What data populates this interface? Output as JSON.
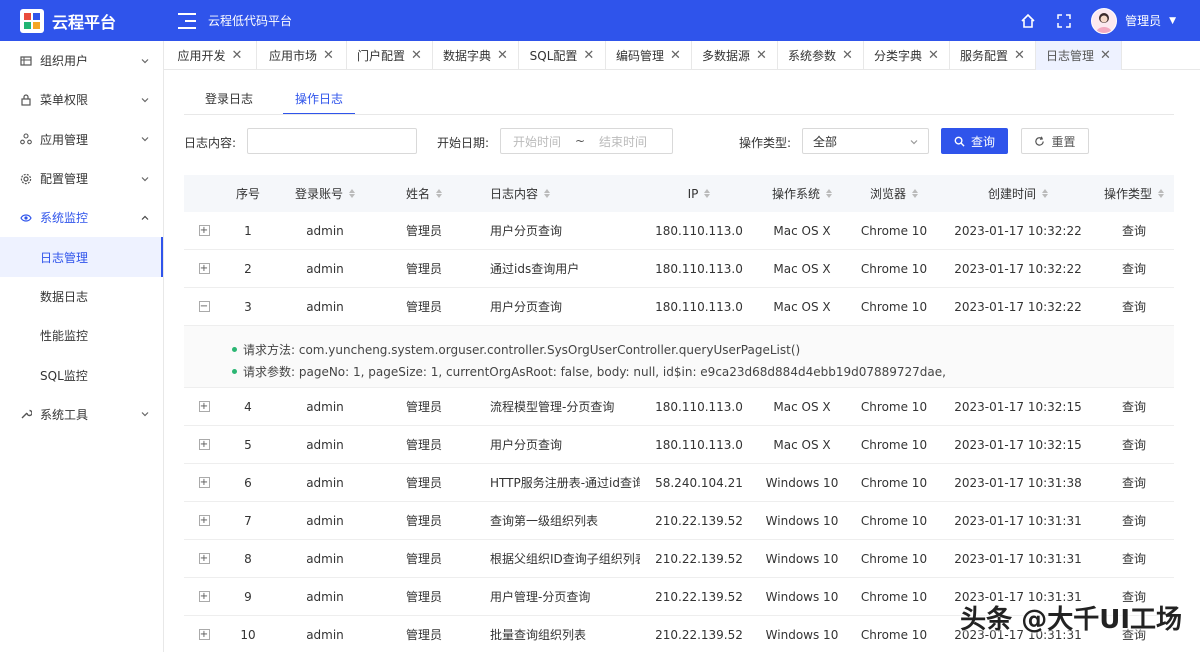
{
  "header": {
    "logo_text": "云程平台",
    "app_title": "云程低代码平台",
    "user_name": "管理员",
    "colors": {
      "primary": "#2f54eb"
    }
  },
  "sidebar": {
    "items": [
      {
        "label": "组织用户",
        "icon": "org-icon",
        "expanded": false
      },
      {
        "label": "菜单权限",
        "icon": "lock-icon",
        "expanded": false
      },
      {
        "label": "应用管理",
        "icon": "app-icon",
        "expanded": false
      },
      {
        "label": "配置管理",
        "icon": "gear-icon",
        "expanded": false
      },
      {
        "label": "系统监控",
        "icon": "eye-icon",
        "expanded": true
      },
      {
        "label": "系统工具",
        "icon": "wrench-icon",
        "expanded": false
      }
    ],
    "sub_items": [
      {
        "label": "日志管理",
        "active": true
      },
      {
        "label": "数据日志",
        "active": false
      },
      {
        "label": "性能监控",
        "active": false
      },
      {
        "label": "SQL监控",
        "active": false
      }
    ]
  },
  "tabs": [
    {
      "label": "应用开发",
      "active": false
    },
    {
      "label": "应用市场",
      "active": false
    },
    {
      "label": "门户配置",
      "active": false
    },
    {
      "label": "数据字典",
      "active": false
    },
    {
      "label": "SQL配置",
      "active": false
    },
    {
      "label": "编码管理",
      "active": false
    },
    {
      "label": "多数据源",
      "active": false
    },
    {
      "label": "系统参数",
      "active": false
    },
    {
      "label": "分类字典",
      "active": false
    },
    {
      "label": "服务配置",
      "active": false
    },
    {
      "label": "日志管理",
      "active": true
    }
  ],
  "subtabs": {
    "login_log": "登录日志",
    "operation_log": "操作日志"
  },
  "filters": {
    "content_label": "日志内容:",
    "date_label": "开始日期:",
    "start_placeholder": "开始时间",
    "range_sep": "~",
    "end_placeholder": "结束时间",
    "type_label": "操作类型:",
    "type_value": "全部",
    "query_button": "查询",
    "reset_button": "重置"
  },
  "table": {
    "columns": [
      "序号",
      "登录账号",
      "姓名",
      "日志内容",
      "IP",
      "操作系统",
      "浏览器",
      "创建时间",
      "操作类型"
    ],
    "rows": [
      {
        "no": "1",
        "account": "admin",
        "name": "管理员",
        "content": "用户分页查询",
        "ip": "180.110.113.0",
        "os": "Mac OS X",
        "browser": "Chrome 10",
        "time": "2023-01-17 10:32:22",
        "type": "查询",
        "expanded": false
      },
      {
        "no": "2",
        "account": "admin",
        "name": "管理员",
        "content": "通过ids查询用户",
        "ip": "180.110.113.0",
        "os": "Mac OS X",
        "browser": "Chrome 10",
        "time": "2023-01-17 10:32:22",
        "type": "查询",
        "expanded": false
      },
      {
        "no": "3",
        "account": "admin",
        "name": "管理员",
        "content": "用户分页查询",
        "ip": "180.110.113.0",
        "os": "Mac OS X",
        "browser": "Chrome 10",
        "time": "2023-01-17 10:32:22",
        "type": "查询",
        "expanded": true
      },
      {
        "no": "4",
        "account": "admin",
        "name": "管理员",
        "content": "流程模型管理-分页查询",
        "ip": "180.110.113.0",
        "os": "Mac OS X",
        "browser": "Chrome 10",
        "time": "2023-01-17 10:32:15",
        "type": "查询",
        "expanded": false
      },
      {
        "no": "5",
        "account": "admin",
        "name": "管理员",
        "content": "用户分页查询",
        "ip": "180.110.113.0",
        "os": "Mac OS X",
        "browser": "Chrome 10",
        "time": "2023-01-17 10:32:15",
        "type": "查询",
        "expanded": false
      },
      {
        "no": "6",
        "account": "admin",
        "name": "管理员",
        "content": "HTTP服务注册表-通过id查询",
        "ip": "58.240.104.21",
        "os": "Windows 10",
        "browser": "Chrome 10",
        "time": "2023-01-17 10:31:38",
        "type": "查询",
        "expanded": false
      },
      {
        "no": "7",
        "account": "admin",
        "name": "管理员",
        "content": "查询第一级组织列表",
        "ip": "210.22.139.52",
        "os": "Windows 10",
        "browser": "Chrome 10",
        "time": "2023-01-17 10:31:31",
        "type": "查询",
        "expanded": false
      },
      {
        "no": "8",
        "account": "admin",
        "name": "管理员",
        "content": "根据父组织ID查询子组织列表",
        "ip": "210.22.139.52",
        "os": "Windows 10",
        "browser": "Chrome 10",
        "time": "2023-01-17 10:31:31",
        "type": "查询",
        "expanded": false
      },
      {
        "no": "9",
        "account": "admin",
        "name": "管理员",
        "content": "用户管理-分页查询",
        "ip": "210.22.139.52",
        "os": "Windows 10",
        "browser": "Chrome 10",
        "time": "2023-01-17 10:31:31",
        "type": "查询",
        "expanded": false
      },
      {
        "no": "10",
        "account": "admin",
        "name": "管理员",
        "content": "批量查询组织列表",
        "ip": "210.22.139.52",
        "os": "Windows 10",
        "browser": "Chrome 10",
        "time": "2023-01-17 10:31:31",
        "type": "查询",
        "expanded": false
      }
    ],
    "detail": {
      "method": "请求方法: com.yuncheng.system.orguser.controller.SysOrgUserController.queryUserPageList()",
      "params": "请求参数: pageNo: 1, pageSize: 1, currentOrgAsRoot: false, body: null, id$in: e9ca23d68d884d4ebb19d07889727dae,"
    }
  },
  "watermark": "头条 @大千UI工场"
}
